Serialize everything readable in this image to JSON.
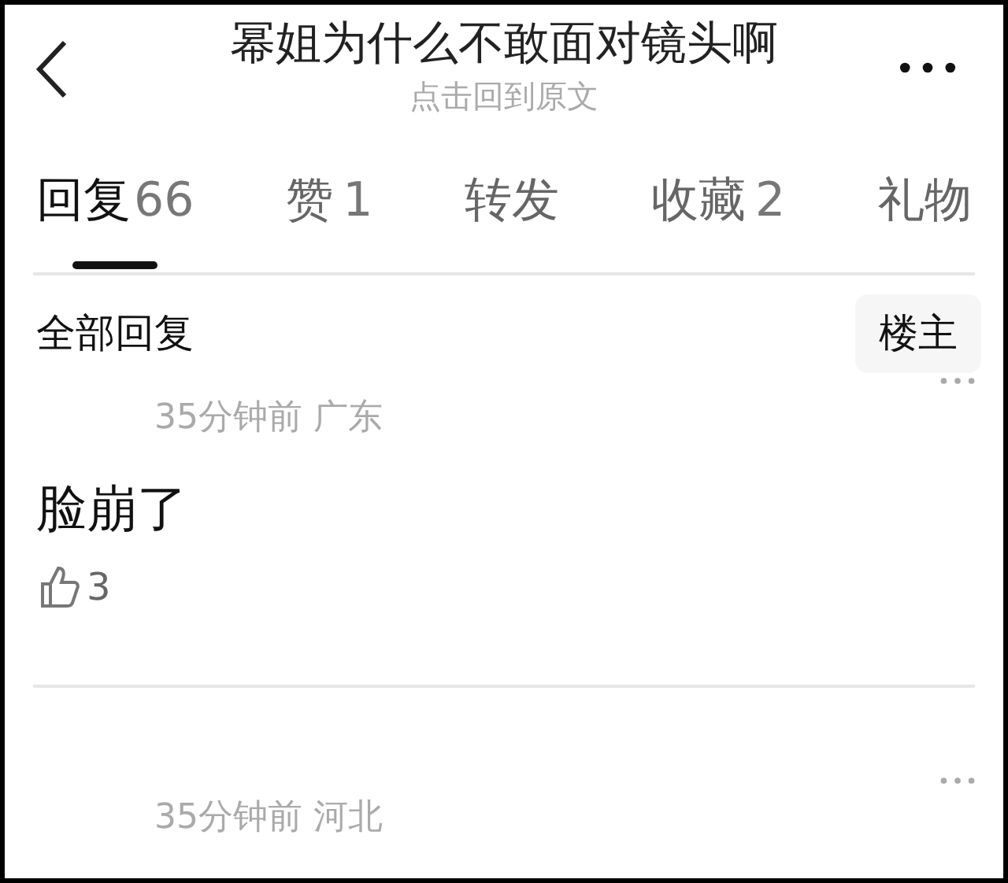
{
  "header": {
    "title": "幂姐为什么不敢面对镜头啊",
    "subtitle": "点击回到原文"
  },
  "tabs": [
    {
      "label": "回复",
      "count": "66",
      "selected": true
    },
    {
      "label": "赞",
      "count": "1",
      "selected": false
    },
    {
      "label": "转发",
      "selected": false
    },
    {
      "label": "收藏",
      "count": "2",
      "selected": false
    },
    {
      "label": "礼物",
      "selected": false
    }
  ],
  "filter": {
    "label": "全部回复",
    "button": "楼主"
  },
  "comments": [
    {
      "meta": "35分钟前 广东",
      "text": "脸崩了",
      "likes": "3"
    },
    {
      "meta": "35分钟前 河北"
    }
  ]
}
